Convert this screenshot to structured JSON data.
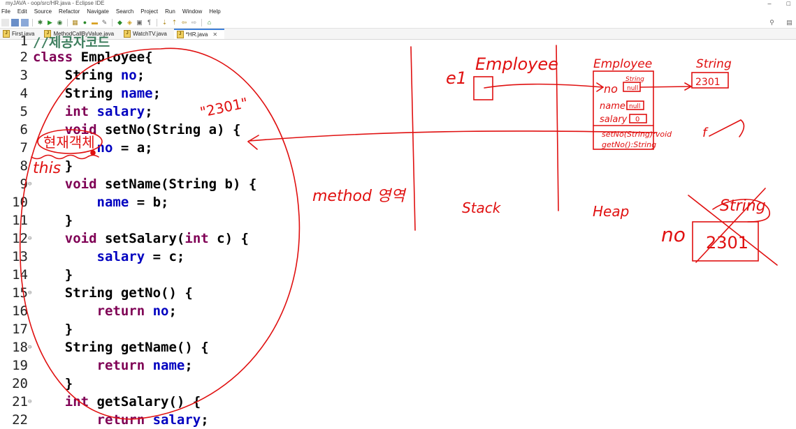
{
  "window": {
    "title": "myJAVA - oop/src/HR.java - Eclipse IDE",
    "controls": [
      "–",
      "□"
    ]
  },
  "menu": [
    "File",
    "Edit",
    "Source",
    "Refactor",
    "Navigate",
    "Search",
    "Project",
    "Run",
    "Window",
    "Help"
  ],
  "tabs": [
    {
      "label": "First.java",
      "active": false
    },
    {
      "label": "MethodCallByValue.java",
      "active": false
    },
    {
      "label": "WatchTV.java",
      "active": false
    },
    {
      "label": "*HR.java",
      "active": true,
      "close": "✕"
    }
  ],
  "code_lines": [
    {
      "n": "1",
      "text": "//제공자코드"
    },
    {
      "n": "2",
      "text": "class Employee{"
    },
    {
      "n": "3",
      "text": "    String no;"
    },
    {
      "n": "4",
      "text": "    String name;"
    },
    {
      "n": "5",
      "text": "    int salary;"
    },
    {
      "n": "6",
      "text": "    void setNo(String a) {"
    },
    {
      "n": "7",
      "text": "        no = a;"
    },
    {
      "n": "8",
      "text": "    }"
    },
    {
      "n": "9",
      "text": "    void setName(String b) {"
    },
    {
      "n": "10",
      "text": "        name = b;"
    },
    {
      "n": "11",
      "text": "    }"
    },
    {
      "n": "12",
      "text": "    void setSalary(int c) {"
    },
    {
      "n": "13",
      "text": "        salary = c;"
    },
    {
      "n": "14",
      "text": "    }"
    },
    {
      "n": "15",
      "text": "    String getNo() {"
    },
    {
      "n": "16",
      "text": "        return no;"
    },
    {
      "n": "17",
      "text": "    }"
    },
    {
      "n": "18",
      "text": "    String getName() {"
    },
    {
      "n": "19",
      "text": "        return name;"
    },
    {
      "n": "20",
      "text": "    }"
    },
    {
      "n": "21",
      "text": "    int getSalary() {"
    },
    {
      "n": "22",
      "text": "        return salary;"
    }
  ],
  "annotations": {
    "label_2301": "\"2301\"",
    "current_object": "현재객체",
    "this": "this",
    "method_area": "method 영역",
    "stack": "Stack",
    "heap": "Heap",
    "e1": "e1",
    "employee_ref": "Employee",
    "employee_obj": "Employee",
    "field_no": "no",
    "string_small": "String",
    "null_value": "null",
    "field_name": "name",
    "field_salary": "salary",
    "zero_value": "0",
    "set_no_sig": "setNo(String):void",
    "get_no_sig": "getNo():String",
    "string_box_label": "String",
    "string_value": "2301",
    "f_label": "f",
    "no_label": "no",
    "string_crossed": "String",
    "value_crossed": "2301"
  },
  "colors": {
    "annotation": "#e01010",
    "keyword": "#7f0055",
    "field": "#0000c0"
  }
}
